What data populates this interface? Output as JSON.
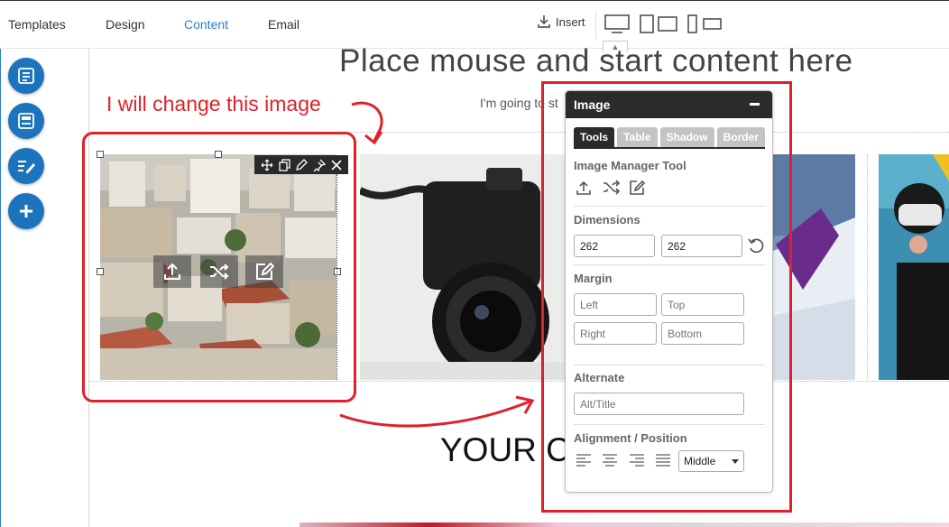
{
  "topbar": {
    "nav": [
      "Templates",
      "Design",
      "Content",
      "Email"
    ],
    "active": "Content",
    "insert_label": "Insert"
  },
  "canvas": {
    "headline": "Place mouse and start content here",
    "subline": "I'm going to st",
    "your_text": "YOUR CO"
  },
  "annotation": {
    "text": "I will change this image",
    "color": "#e0202a"
  },
  "panel": {
    "title": "Image",
    "tabs": [
      "Tools",
      "Table",
      "Shadow",
      "Border"
    ],
    "active_tab": "Tools",
    "sections": {
      "image_manager": "Image Manager Tool",
      "dimensions": "Dimensions",
      "margin": "Margin",
      "alternate": "Alternate",
      "alignment": "Alignment / Position"
    },
    "dimensions": {
      "width": "262",
      "height": "262"
    },
    "margin": {
      "left": "Left",
      "top": "Top",
      "right": "Right",
      "bottom": "Bottom"
    },
    "alt_placeholder": "Alt/Title",
    "position": "Middle"
  },
  "colors": {
    "accent": "#2a7fcf",
    "fab": "#1c75bc",
    "panel_header": "#2b2b2b",
    "annotation": "#e0202a"
  }
}
